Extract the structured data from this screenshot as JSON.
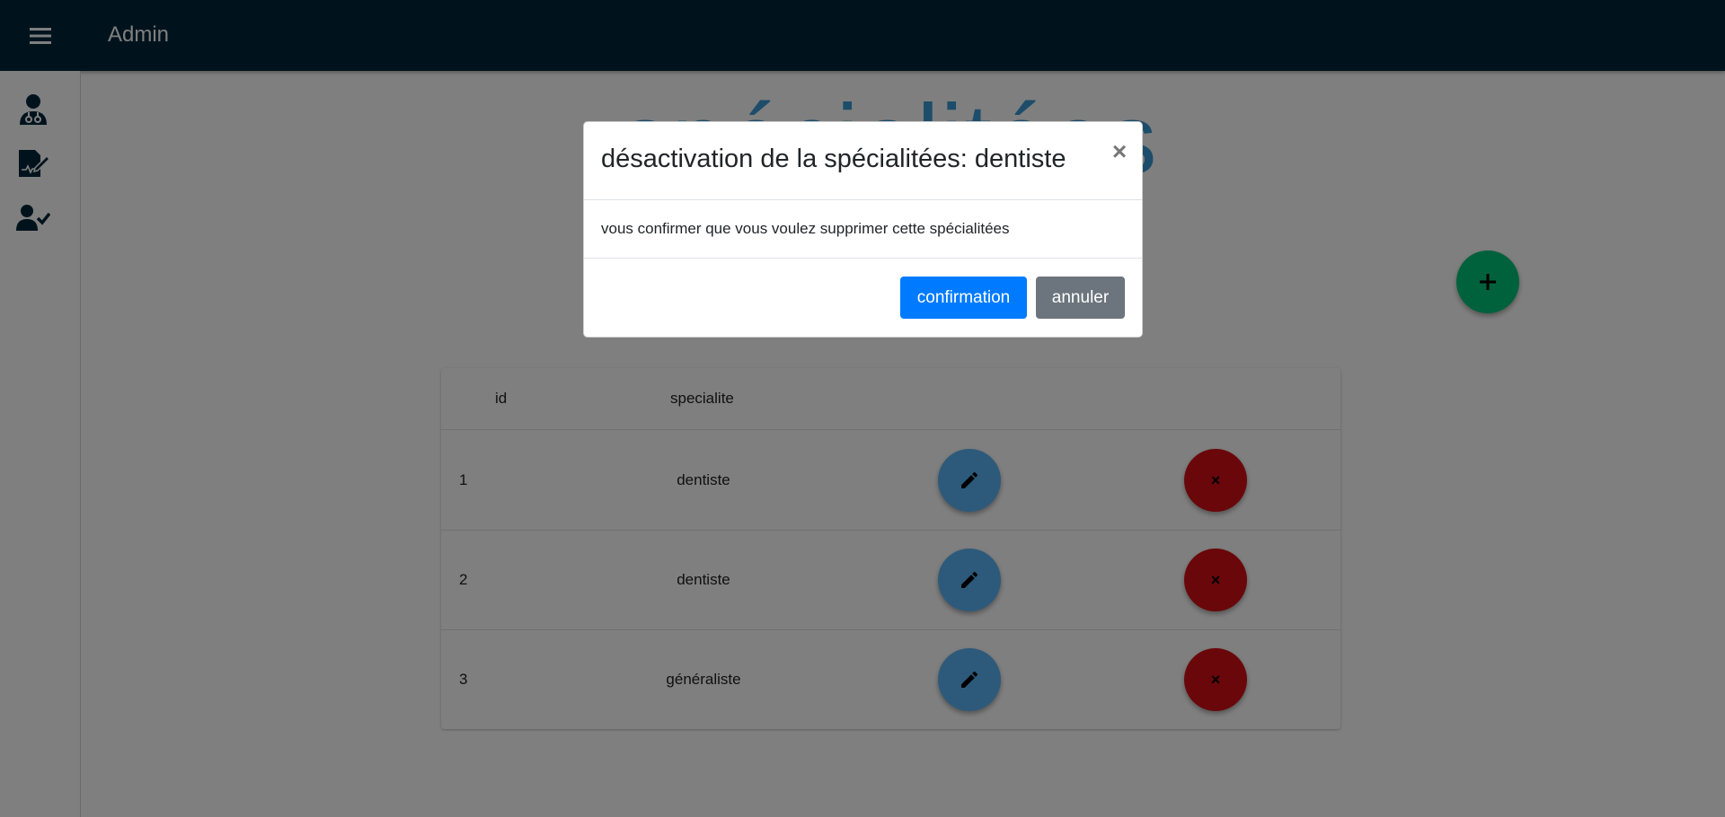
{
  "appbar": {
    "title": "Admin",
    "menu_icon": "menu-icon",
    "background": "#00263a"
  },
  "sidebar": {
    "items": [
      {
        "icon": "doctor-icon"
      },
      {
        "icon": "medical-report-edit-icon"
      },
      {
        "icon": "user-check-icon"
      }
    ]
  },
  "main": {
    "page_title": "spécialitées",
    "add_button_icon": "plus-icon",
    "table": {
      "columns": [
        "id",
        "specialite"
      ],
      "rows": [
        {
          "id": "1",
          "specialite": "dentiste"
        },
        {
          "id": "2",
          "specialite": "dentiste"
        },
        {
          "id": "3",
          "specialite": "généraliste"
        }
      ],
      "edit_icon": "pencil-icon",
      "delete_label": "×"
    }
  },
  "modal": {
    "title": "désactivation de la spécialitées: dentiste",
    "close_label": "×",
    "body": "vous confirmer que vous voulez supprimer cette spécialitées",
    "confirm_label": "confirmation",
    "cancel_label": "annuler"
  },
  "colors": {
    "accent": "#007bff",
    "add_fab": "#00c37a",
    "edit_fab": "#5ab4f5",
    "delete_fab": "#d40f14"
  }
}
